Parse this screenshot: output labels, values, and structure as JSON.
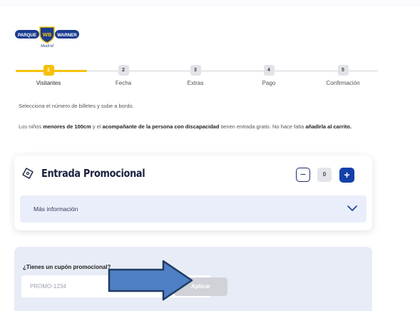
{
  "logo": {
    "left_text": "PARQUE",
    "center_text": "WB",
    "right_text": "WARNER",
    "sub_text": "Madrid",
    "color": "#1b3d8f",
    "accent": "#f6c10c"
  },
  "stepper": {
    "steps": [
      {
        "num": "1",
        "label": "Visitantes"
      },
      {
        "num": "2",
        "label": "Fecha"
      },
      {
        "num": "3",
        "label": "Extras"
      },
      {
        "num": "4",
        "label": "Pago"
      },
      {
        "num": "5",
        "label": "Confirmación"
      }
    ],
    "active_index": 0,
    "active_color": "#f6c10c"
  },
  "intro": "Selecciona el número de billetes y sube a bordo.",
  "note": {
    "part1": "Los niños ",
    "bold1": "menores de 100cm",
    "part2": " y el ",
    "bold2": "acompañante de la persona con discapacidad",
    "part3": " tienen entrada gratis. No hace falta ",
    "bold3": "añadirla al carrito."
  },
  "ticket": {
    "icon": "ticket-icon",
    "title": "Entrada Promocional",
    "minus_label": "−",
    "quantity": "0",
    "plus_label": "+",
    "plus_color": "#1540a8",
    "more_info_label": "Más información",
    "more_info_icon": "chevron-down-icon"
  },
  "coupon": {
    "question": "¿Tienes un cupón promocional?",
    "placeholder": "PROMO-1234",
    "value": "",
    "apply_label": "Aplicar"
  },
  "annotation": {
    "icon": "arrow-right-icon",
    "fill": "#4f7fc4",
    "stroke": "#1f3a63"
  }
}
